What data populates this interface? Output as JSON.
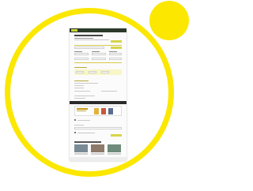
{
  "decor": {
    "ring_color": "#fbe700",
    "accent_color": "#d6d54a",
    "dark_bar_color": "#2b2b2b"
  },
  "icons": {
    "logo": "site-logo",
    "checkbox": "checkbox-square"
  }
}
